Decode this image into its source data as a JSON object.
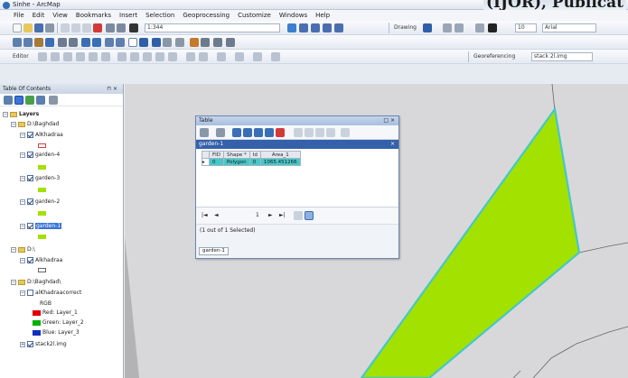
{
  "window": {
    "title": "Sinhe - ArcMap"
  },
  "overlay_text": "(IJOR), Publicat",
  "menu": [
    "File",
    "Edit",
    "View",
    "Bookmarks",
    "Insert",
    "Selection",
    "Geoprocessing",
    "Customize",
    "Windows",
    "Help"
  ],
  "toolbar_1": {
    "scale_field": "1:344",
    "font_size_field": "10",
    "drawing_label": "Drawing",
    "font_name_field": "Arial"
  },
  "toolbar_3": {
    "editor_label": "Editor",
    "georef_label": "Georeferencing",
    "georef_layer": "stack 2l.img"
  },
  "toc": {
    "title": "Table Of Contents",
    "pin": "⊓ ×",
    "layers_label": "Layers",
    "group1": "D:\\Baghdad",
    "items": [
      {
        "label": "AlKhadraa",
        "checked": true,
        "swatch": "#ffffff"
      },
      {
        "label": "garden-4",
        "checked": true,
        "swatch": "#a2e100"
      },
      {
        "label": "garden-3",
        "checked": true,
        "swatch": "#a2e100"
      },
      {
        "label": "garden-2",
        "checked": true,
        "swatch": "#a2e100"
      },
      {
        "label": "garden-1",
        "checked": true,
        "swatch": "#a2e100",
        "selected": true
      }
    ],
    "group2": "D:\\",
    "group2_item": "Alkhadraa",
    "group3": "D:\\Baghdad\\",
    "raster_layer": "alKhadraacorrect",
    "rgb_label": "RGB",
    "bands": [
      {
        "label": "Red: Layer_1",
        "color": "#e00000"
      },
      {
        "label": "Green: Layer_2",
        "color": "#00b000"
      },
      {
        "label": "Blue: Layer_3",
        "color": "#1030c0"
      }
    ],
    "last_layer": "stack2l.img"
  },
  "table": {
    "title": "Table",
    "controls": "□ ×",
    "layer_tab": "garden-1",
    "columns": [
      "FID",
      "Shape *",
      "Id",
      "Area_1"
    ],
    "rows": [
      [
        "0",
        "Polygon",
        "0",
        "1065.451266"
      ]
    ],
    "nav": {
      "first": "|◄",
      "prev": "◄",
      "record": "1",
      "next": "►",
      "last": "►|"
    },
    "status": "(1 out of 1 Selected)",
    "sheet_tab": "garden-1"
  },
  "map": {
    "polygon_fill": "#a2e100",
    "polygon_outline": "#45c8c8",
    "background": "#d8d8da"
  }
}
